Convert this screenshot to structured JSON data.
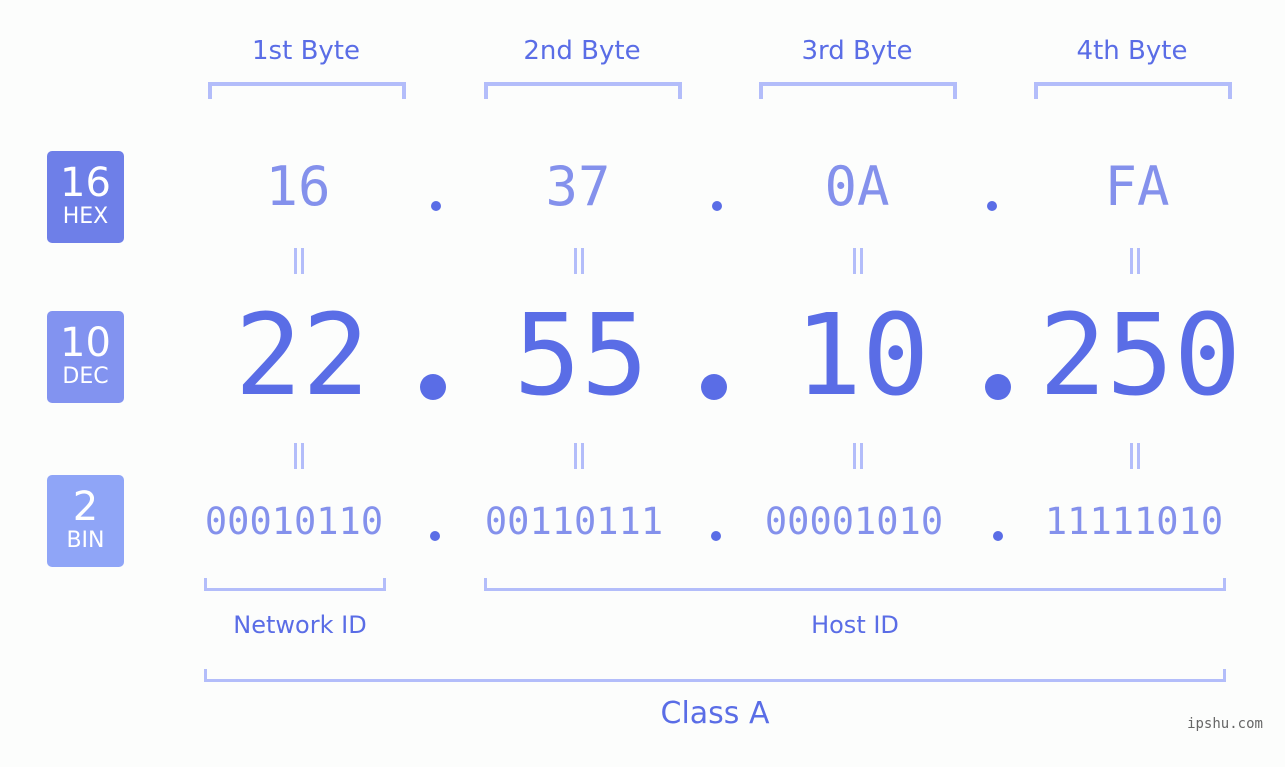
{
  "byte_headers": [
    "1st Byte",
    "2nd Byte",
    "3rd Byte",
    "4th Byte"
  ],
  "bases": {
    "hex": {
      "number": "16",
      "label": "HEX",
      "color": "#6e7fe8"
    },
    "dec": {
      "number": "10",
      "label": "DEC",
      "color": "#8293f0"
    },
    "bin": {
      "number": "2",
      "label": "BIN",
      "color": "#8fa5f7"
    }
  },
  "ip": {
    "hex": [
      "16",
      "37",
      "0A",
      "FA"
    ],
    "dec": [
      "22",
      "55",
      "10",
      "250"
    ],
    "bin": [
      "00010110",
      "00110111",
      "00001010",
      "11111010"
    ],
    "separator": ".",
    "equals": "="
  },
  "segments": {
    "network_id": "Network ID",
    "host_id": "Host ID",
    "class": "Class A"
  },
  "watermark": "ipshu.com",
  "colors": {
    "accent": "#5a6de6",
    "light_value": "#8491ec",
    "bracket": "#b3bdfa",
    "background": "#fcfdfc"
  }
}
